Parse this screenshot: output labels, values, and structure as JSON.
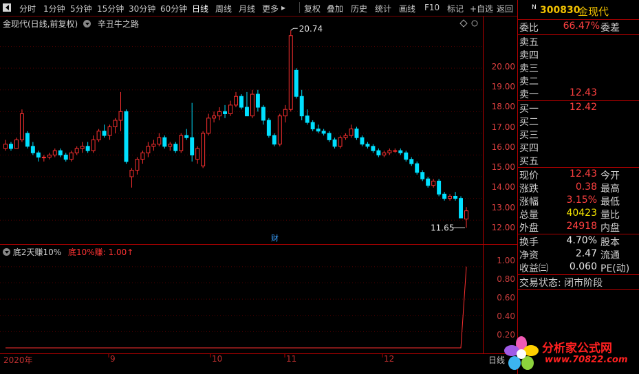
{
  "toolbar": {
    "left": [
      {
        "label": "分时"
      },
      {
        "label": "1分钟"
      },
      {
        "label": "5分钟"
      },
      {
        "label": "15分钟"
      },
      {
        "label": "30分钟"
      },
      {
        "label": "60分钟"
      },
      {
        "label": "日线"
      },
      {
        "label": "周线"
      },
      {
        "label": "月线"
      },
      {
        "label": "更多"
      }
    ],
    "right": [
      {
        "label": "复权"
      },
      {
        "label": "叠加"
      },
      {
        "label": "历史"
      },
      {
        "label": "统计"
      },
      {
        "label": "画线"
      },
      {
        "label": "F10"
      },
      {
        "label": "标记"
      },
      {
        "label": "+自选"
      },
      {
        "label": "返回"
      }
    ],
    "more_arrow": "▸"
  },
  "main": {
    "title": "金现代(日线,前复权)",
    "formula": "辛丑牛之路",
    "high_label": "20.74",
    "low_label": "11.65",
    "fin_badge": "财",
    "yticks": [
      "20.00",
      "19.00",
      "18.00",
      "17.00",
      "16.00",
      "15.00",
      "14.00",
      "13.00",
      "12.00"
    ]
  },
  "sub": {
    "name": "底2天赚10%",
    "value_label": "底10%赚: 1.00↑",
    "yticks": [
      "1.00",
      "0.80",
      "0.60",
      "0.40",
      "0.20"
    ]
  },
  "xaxis": {
    "labels": [
      "2020年",
      "9",
      "10",
      "11",
      "12"
    ],
    "period": "日线"
  },
  "panel": {
    "badge": "N",
    "code": "300830",
    "name": "金现代",
    "weibi": {
      "k": "委比",
      "v": "66.47%",
      "k2": "委差"
    },
    "sells": [
      {
        "k": "卖五",
        "v": ""
      },
      {
        "k": "卖四",
        "v": ""
      },
      {
        "k": "卖三",
        "v": ""
      },
      {
        "k": "卖二",
        "v": ""
      },
      {
        "k": "卖一",
        "v": "12.43"
      }
    ],
    "buys": [
      {
        "k": "买一",
        "v": "12.42"
      },
      {
        "k": "买二",
        "v": ""
      },
      {
        "k": "买三",
        "v": ""
      },
      {
        "k": "买四",
        "v": ""
      },
      {
        "k": "买五",
        "v": ""
      }
    ],
    "quote": [
      {
        "k": "现价",
        "v": "12.43",
        "k2": "今开"
      },
      {
        "k": "涨跌",
        "v": "0.38",
        "k2": "最高"
      },
      {
        "k": "涨幅",
        "v": "3.15%",
        "k2": "最低"
      },
      {
        "k": "总量",
        "v": "40423",
        "k2": "量比"
      },
      {
        "k": "外盘",
        "v": "24918",
        "k2": "内盘"
      }
    ],
    "stats": [
      {
        "k": "换手",
        "v": "4.70%",
        "k2": "股本"
      },
      {
        "k": "净资",
        "v": "2.47",
        "k2": "流通"
      },
      {
        "k": "收益㈢",
        "v": "0.060",
        "k2": "PE(动)"
      }
    ],
    "trade_status": "交易状态: 闭市阶段"
  },
  "watermark": {
    "line1": "分析家公式网",
    "line2": "www.70822.com"
  },
  "colors": {
    "up": "#ff3030",
    "down": "#00e0ff",
    "axis": "#b00000",
    "bg": "#000000"
  },
  "chart_data": {
    "type": "candlestick",
    "ylim": [
      11.5,
      21.0
    ],
    "candles": [
      [
        15.3,
        15.7,
        15.2,
        15.5
      ],
      [
        15.5,
        15.6,
        15.2,
        15.3
      ],
      [
        15.3,
        15.8,
        15.3,
        15.7
      ],
      [
        15.7,
        17.1,
        15.6,
        16.9
      ],
      [
        16.0,
        16.1,
        15.3,
        15.4
      ],
      [
        15.4,
        15.6,
        15.0,
        15.1
      ],
      [
        15.1,
        15.2,
        14.7,
        14.9
      ],
      [
        14.9,
        15.0,
        14.7,
        14.9
      ],
      [
        14.9,
        15.1,
        14.8,
        15.0
      ],
      [
        15.0,
        15.3,
        14.9,
        15.2
      ],
      [
        15.2,
        15.3,
        14.9,
        15.0
      ],
      [
        15.0,
        15.1,
        14.7,
        14.8
      ],
      [
        14.8,
        15.2,
        14.7,
        15.1
      ],
      [
        15.1,
        15.4,
        15.0,
        15.3
      ],
      [
        15.3,
        15.6,
        15.1,
        15.4
      ],
      [
        15.4,
        15.6,
        15.1,
        15.2
      ],
      [
        15.2,
        15.9,
        15.1,
        15.7
      ],
      [
        15.7,
        16.2,
        15.6,
        16.1
      ],
      [
        16.1,
        16.4,
        15.8,
        15.9
      ],
      [
        15.9,
        16.4,
        15.7,
        16.3
      ],
      [
        16.3,
        16.7,
        16.0,
        16.6
      ],
      [
        16.6,
        17.9,
        16.1,
        17.0
      ],
      [
        17.0,
        17.1,
        14.6,
        14.7
      ],
      [
        14.0,
        14.4,
        13.5,
        14.3
      ],
      [
        14.3,
        14.9,
        14.1,
        14.8
      ],
      [
        14.8,
        15.2,
        14.6,
        15.1
      ],
      [
        15.1,
        15.6,
        14.9,
        15.4
      ],
      [
        15.4,
        15.7,
        15.2,
        15.5
      ],
      [
        15.5,
        16.0,
        15.4,
        15.8
      ],
      [
        15.8,
        15.9,
        15.3,
        15.4
      ],
      [
        15.4,
        15.6,
        15.2,
        15.5
      ],
      [
        15.5,
        15.6,
        15.1,
        15.2
      ],
      [
        15.2,
        16.0,
        15.1,
        15.9
      ],
      [
        15.9,
        16.2,
        15.7,
        15.8
      ],
      [
        15.8,
        17.4,
        14.7,
        15.0
      ],
      [
        14.8,
        15.4,
        14.6,
        15.3
      ],
      [
        14.5,
        16.1,
        14.4,
        16.0
      ],
      [
        16.0,
        16.9,
        15.9,
        16.7
      ],
      [
        16.7,
        17.0,
        16.5,
        16.8
      ],
      [
        16.8,
        17.2,
        16.6,
        17.0
      ],
      [
        17.0,
        17.3,
        16.7,
        16.9
      ],
      [
        16.9,
        17.5,
        16.8,
        17.3
      ],
      [
        17.3,
        17.9,
        17.2,
        17.7
      ],
      [
        17.7,
        17.8,
        17.1,
        17.2
      ],
      [
        17.2,
        17.9,
        16.9,
        16.8
      ],
      [
        16.8,
        18.0,
        16.7,
        17.8
      ],
      [
        17.8,
        18.0,
        17.0,
        17.2
      ],
      [
        17.2,
        17.3,
        16.4,
        16.6
      ],
      [
        16.6,
        16.7,
        15.8,
        15.9
      ],
      [
        15.9,
        16.0,
        15.4,
        15.5
      ],
      [
        15.5,
        16.9,
        15.4,
        16.8
      ],
      [
        16.8,
        17.3,
        16.5,
        17.1
      ],
      [
        17.1,
        20.74,
        17.0,
        20.5
      ],
      [
        18.9,
        19.0,
        17.6,
        17.7
      ],
      [
        17.7,
        18.0,
        16.6,
        16.8
      ],
      [
        16.8,
        17.1,
        16.4,
        16.5
      ],
      [
        16.5,
        16.6,
        16.1,
        16.2
      ],
      [
        16.2,
        16.4,
        16.0,
        16.1
      ],
      [
        16.1,
        16.2,
        15.9,
        16.0
      ],
      [
        16.0,
        16.1,
        15.6,
        15.7
      ],
      [
        15.7,
        15.8,
        15.3,
        15.4
      ],
      [
        15.4,
        15.9,
        15.3,
        15.8
      ],
      [
        15.8,
        16.0,
        15.7,
        15.9
      ],
      [
        15.9,
        16.4,
        15.8,
        16.2
      ],
      [
        16.2,
        16.3,
        15.7,
        15.8
      ],
      [
        15.8,
        15.9,
        15.4,
        15.5
      ],
      [
        15.5,
        15.6,
        15.3,
        15.4
      ],
      [
        15.4,
        15.5,
        15.1,
        15.2
      ],
      [
        15.2,
        15.3,
        14.9,
        15.0
      ],
      [
        15.0,
        15.2,
        14.9,
        15.1
      ],
      [
        15.1,
        15.3,
        15.0,
        15.2
      ],
      [
        15.2,
        15.3,
        15.1,
        15.2
      ],
      [
        15.2,
        15.3,
        15.0,
        15.1
      ],
      [
        15.1,
        15.2,
        14.7,
        14.8
      ],
      [
        14.8,
        14.9,
        14.5,
        14.6
      ],
      [
        14.6,
        14.7,
        14.1,
        14.2
      ],
      [
        14.2,
        14.3,
        13.8,
        13.9
      ],
      [
        13.9,
        14.0,
        13.5,
        13.6
      ],
      [
        13.6,
        13.9,
        13.5,
        13.8
      ],
      [
        13.8,
        13.9,
        13.1,
        13.2
      ],
      [
        13.2,
        13.3,
        12.9,
        13.0
      ],
      [
        13.0,
        13.2,
        12.9,
        13.1
      ],
      [
        13.1,
        13.3,
        12.9,
        13.0
      ],
      [
        13.0,
        13.1,
        12.1,
        12.1
      ],
      [
        12.05,
        12.6,
        11.65,
        12.43
      ]
    ],
    "signal": {
      "values_tail": [
        0,
        0,
        0,
        0,
        1.0
      ],
      "ylim": [
        0,
        1.1
      ]
    }
  }
}
